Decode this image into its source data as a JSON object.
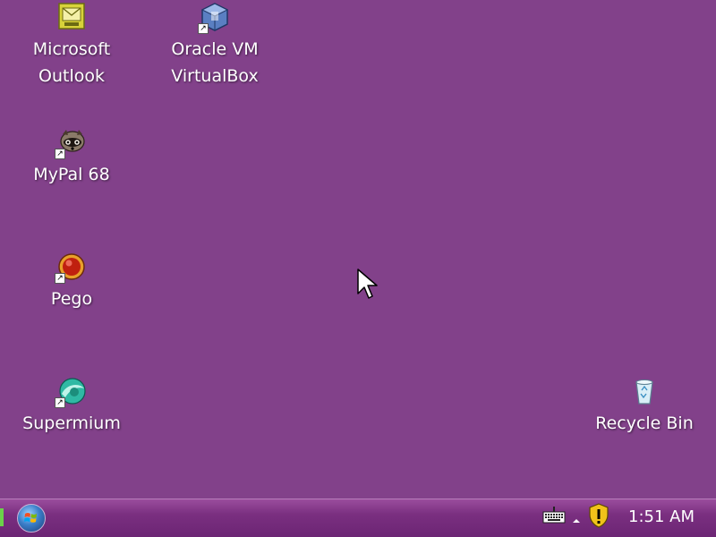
{
  "desktop": {
    "background_color": "#82418a",
    "icons": [
      {
        "label_line1": "Microsoft",
        "label_line2": "Outlook",
        "icon": "outlook-icon"
      },
      {
        "label_line1": "Oracle VM",
        "label_line2": "VirtualBox",
        "icon": "virtualbox-icon"
      },
      {
        "label": "MyPal 68",
        "icon": "mypal-icon"
      },
      {
        "label": "Pego",
        "icon": "pego-icon"
      },
      {
        "label": "Supermium",
        "icon": "supermium-icon"
      },
      {
        "label": "Recycle Bin",
        "icon": "recycle-bin-icon"
      }
    ]
  },
  "taskbar": {
    "start_button_icon": "windows-start-orb-icon",
    "tray_icons": [
      "keyboard-icon",
      "show-hidden-icons-chevron",
      "security-shield-icon"
    ],
    "clock": "1:51 AM"
  }
}
